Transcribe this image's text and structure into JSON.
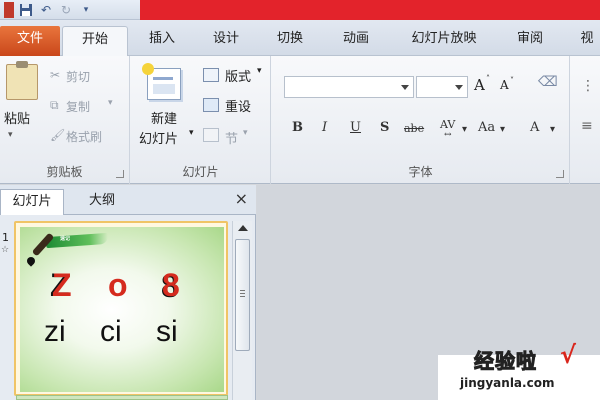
{
  "tabs": [
    "文件",
    "开始",
    "插入",
    "设计",
    "切换",
    "动画",
    "幻灯片放映",
    "审阅",
    "视"
  ],
  "clipboard": {
    "paste": "粘贴",
    "cut": "剪切",
    "copy": "复制",
    "format_painter": "格式刷",
    "label": "剪贴板"
  },
  "slides_group": {
    "new_slide_line1": "新建",
    "new_slide_line2": "幻灯片",
    "layout": "版式",
    "reset": "重设",
    "section": "节",
    "label": "幻灯片"
  },
  "font": {
    "label": "字体",
    "bold": "B",
    "italic": "I",
    "underline": "U",
    "shadow": "S",
    "strike": "abe",
    "spacing": "AV",
    "case": "Aa",
    "color": "A",
    "grow": "A",
    "shrink": "A"
  },
  "panel": {
    "tab_slides": "幻灯片",
    "tab_outline": "大纲",
    "close": "×"
  },
  "slide1": {
    "number": "1",
    "star": "☆",
    "brush_text": "速记",
    "chars": [
      "Z",
      "o",
      "8"
    ],
    "pinyin": [
      "zi",
      "ci",
      "si"
    ]
  },
  "watermark": {
    "text": "经验啦",
    "check": "√",
    "url": "jingyanla.com"
  }
}
